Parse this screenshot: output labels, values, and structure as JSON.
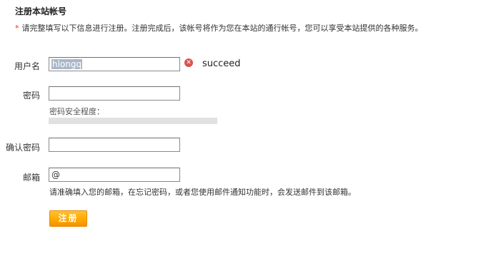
{
  "page": {
    "title": "注册本站帐号",
    "notice_star": "*",
    "notice": "请完整填写以下信息进行注册。注册完成后，该帐号将作为您在本站的通行帐号，您可以享受本站提供的各种服务。"
  },
  "form": {
    "username": {
      "label": "用户名",
      "value": "hlongq",
      "status_icon": "error-icon",
      "status_text": "succeed"
    },
    "password": {
      "label": "密码",
      "value": "",
      "strength_label": "密码安全程度：",
      "strength_level": 0
    },
    "confirm_password": {
      "label": "确认密码",
      "value": ""
    },
    "email": {
      "label": "邮箱",
      "value": "@",
      "hint": "请准确填入您的邮箱，在忘记密码，或者您使用邮件通知功能时，会发送邮件到该邮箱。"
    },
    "submit_label": "注册"
  },
  "colors": {
    "required_star": "#e03b00",
    "error_icon": "#d9534f",
    "submit_button": "#ffa800",
    "strength_track": "#e1e1e1"
  }
}
